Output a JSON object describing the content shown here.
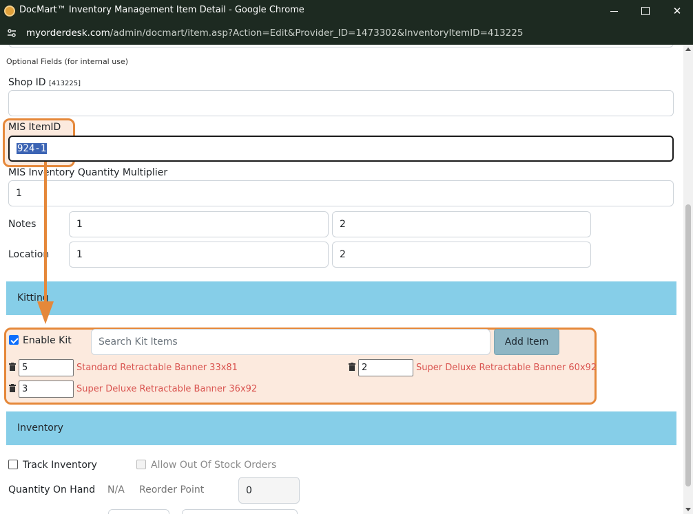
{
  "window": {
    "title": "DocMart™ Inventory Management Item Detail - Google Chrome",
    "url_host": "myorderdesk.com",
    "url_path": "/admin/docmart/item.asp?Action=Edit&Provider_ID=1473302&InventoryItemID=413225"
  },
  "form": {
    "optional_heading": "Optional Fields (for internal use)",
    "shop_id_label": "Shop ID",
    "shop_id_tag": "[413225]",
    "shop_id_value": "",
    "mis_itemid_label": "MIS ItemID",
    "mis_itemid_value": "924-1",
    "mis_multiplier_label": "MIS Inventory Quantity Multiplier",
    "mis_multiplier_value": "1",
    "notes_label": "Notes",
    "notes_1": "1",
    "notes_2": "2",
    "location_label": "Location",
    "location_1": "1",
    "location_2": "2"
  },
  "kitting": {
    "section_title": "Kitting",
    "enable_kit_label": "Enable Kit",
    "enable_kit_checked": true,
    "search_placeholder": "Search Kit Items",
    "add_item_label": "Add Item",
    "items": [
      {
        "qty": "5",
        "name": "Standard Retractable Banner 33x81"
      },
      {
        "qty": "2",
        "name": "Super Deluxe Retractable Banner 60x92"
      },
      {
        "qty": "3",
        "name": "Super Deluxe Retractable Banner 36x92"
      }
    ]
  },
  "inventory": {
    "section_title": "Inventory",
    "track_label": "Track Inventory",
    "allow_oos_label": "Allow Out Of Stock Orders",
    "qty_on_hand_label": "Quantity On Hand",
    "qty_on_hand_value": "N/A",
    "reorder_label": "Reorder Point",
    "reorder_value": "0"
  },
  "colors": {
    "highlight": "#e5883a",
    "band": "#86cee8",
    "link_red": "#d9534f"
  }
}
